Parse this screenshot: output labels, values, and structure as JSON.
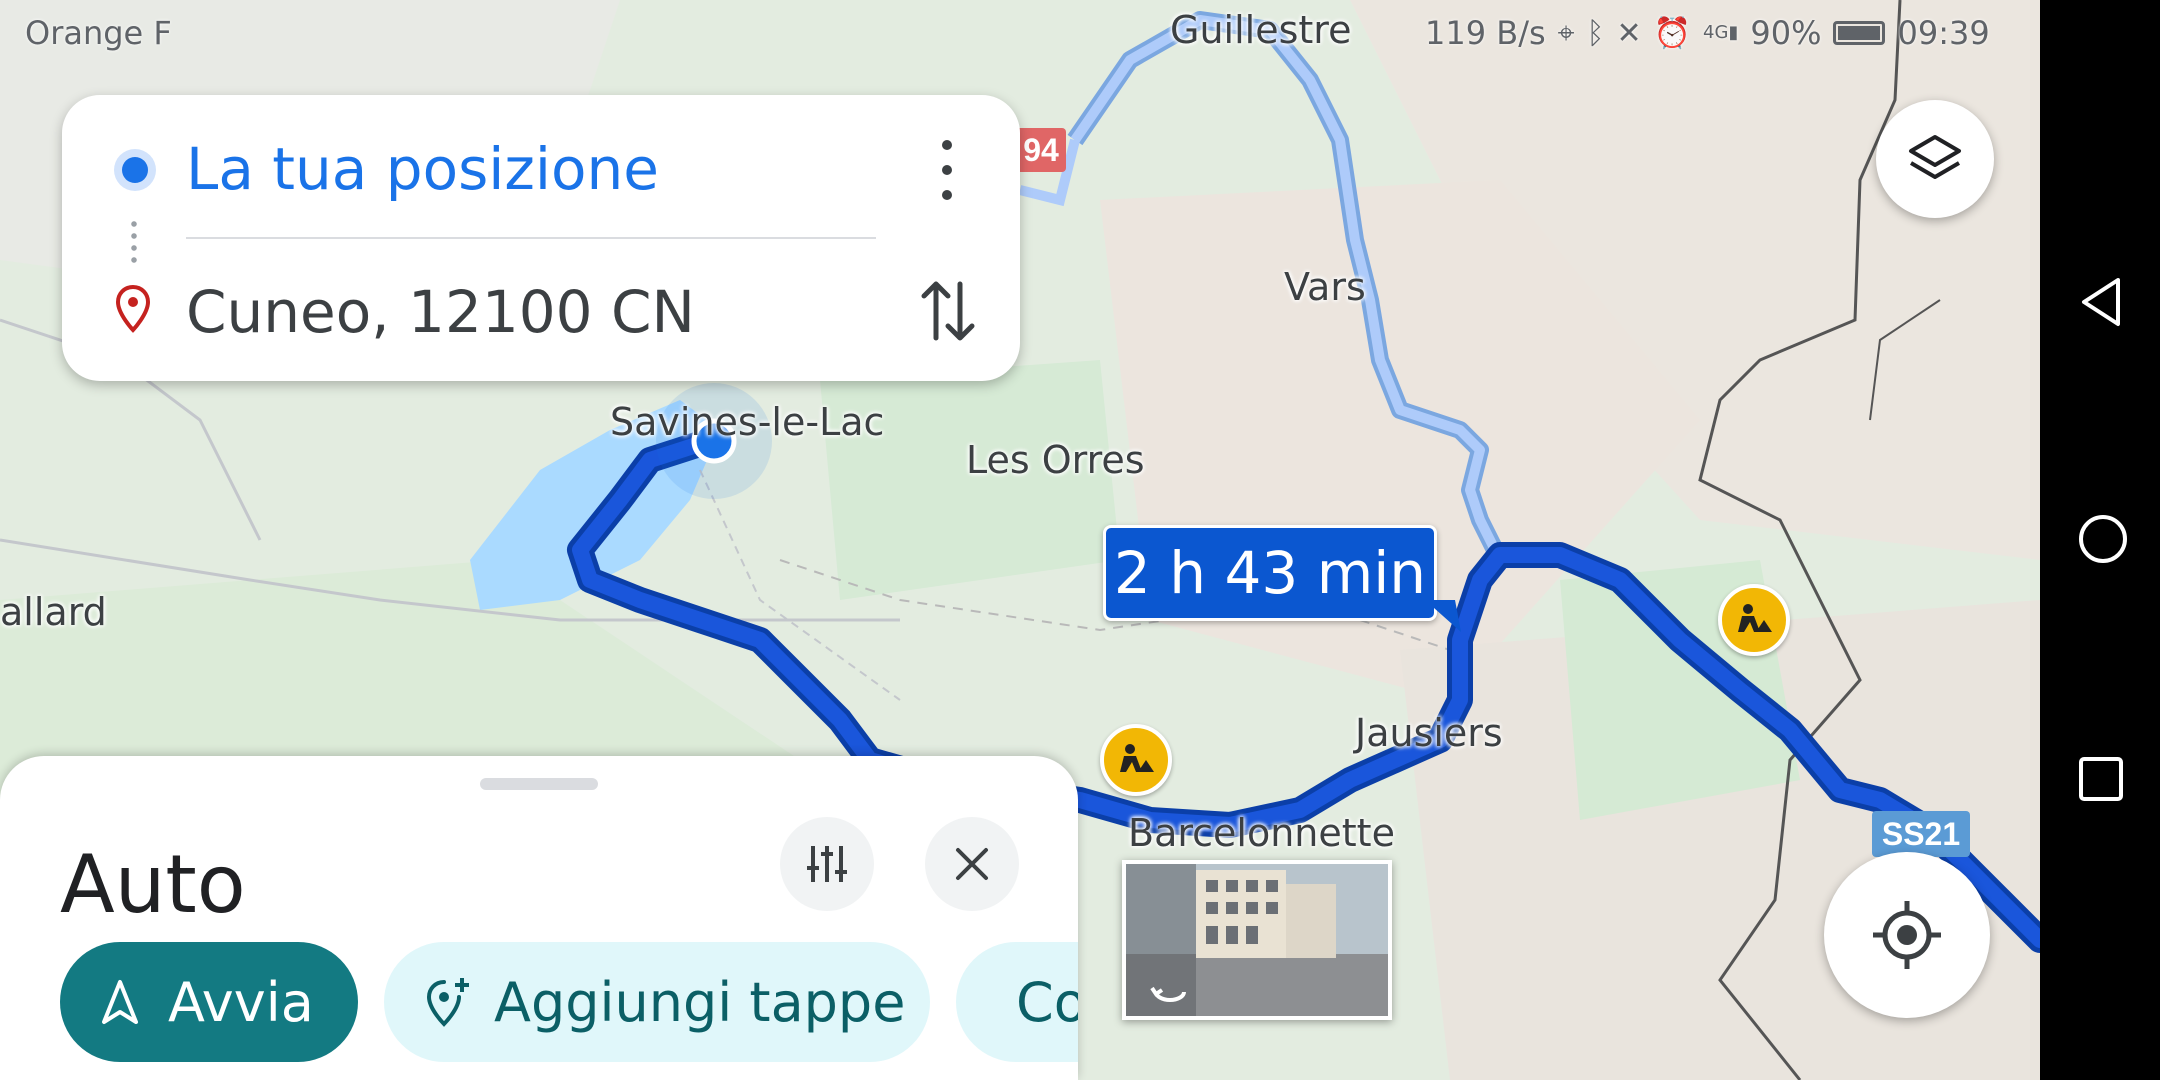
{
  "status_bar": {
    "carrier": "Orange F",
    "net_speed": "119 B/s",
    "signal_label": "4G",
    "battery": "90%",
    "battery_level": 0.9,
    "time": "09:39"
  },
  "route_card": {
    "origin": "La tua posizione",
    "destination": "Cuneo, 12100 CN"
  },
  "map": {
    "places": {
      "guillestre": "Guillestre",
      "vars": "Vars",
      "savines": "Savines-le-Lac",
      "les_orres": "Les Orres",
      "jausiers": "Jausiers",
      "barcelonnette": "Barcelonnette",
      "allard": "allard"
    },
    "road_badges": {
      "d94": "94",
      "ss21": "SS21"
    },
    "route_time": "2 h 43 min",
    "colors": {
      "route": "#1a56db",
      "alt_route": "#aecbfa",
      "water": "#aadaff"
    }
  },
  "sheet": {
    "mode": "Auto",
    "start_label": "Avvia",
    "add_stops_label": "Aggiungi tappe",
    "share_label": "Condividi"
  },
  "icons": {
    "layers": "layers-icon",
    "locate": "my-location-icon",
    "filter": "tune-icon",
    "close": "close-icon",
    "swap": "swap-vertical-icon",
    "start": "navigation-arrow-icon",
    "add_stop": "add-location-icon",
    "share": "share-icon",
    "roadworks": "construction-icon"
  }
}
